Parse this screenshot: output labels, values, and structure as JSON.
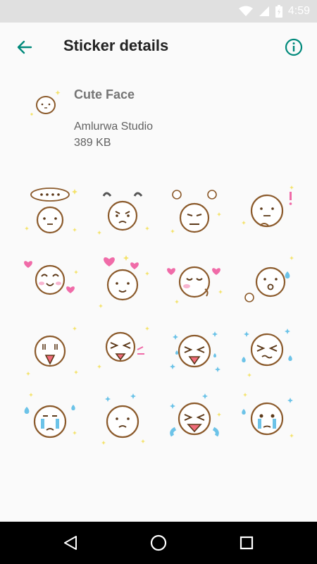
{
  "status_bar": {
    "time": "4:59",
    "icons": [
      "wifi-icon",
      "signal-icon",
      "battery-icon"
    ]
  },
  "app_bar": {
    "title": "Sticker details",
    "back_icon": "arrow-back-icon",
    "info_icon": "info-icon",
    "accent_color": "#00897b"
  },
  "pack": {
    "name": "Cute Face",
    "publisher": "Amlurwa Studio",
    "size": "389 KB"
  },
  "stickers": [
    {
      "expression": "speech-bubble-neutral"
    },
    {
      "expression": "annoyed"
    },
    {
      "expression": "grumpy-steam"
    },
    {
      "expression": "thinking-exclaim"
    },
    {
      "expression": "happy-hearts"
    },
    {
      "expression": "in-love"
    },
    {
      "expression": "blushing-hearts"
    },
    {
      "expression": "surprised-sweat"
    },
    {
      "expression": "shocked"
    },
    {
      "expression": "laughing"
    },
    {
      "expression": "laughing-sparkles"
    },
    {
      "expression": "crying-sweat"
    },
    {
      "expression": "crying-tears"
    },
    {
      "expression": "sad"
    },
    {
      "expression": "bawling"
    },
    {
      "expression": "teary"
    }
  ],
  "nav_bar": {
    "icons": [
      "nav-back-icon",
      "nav-home-icon",
      "nav-recents-icon"
    ]
  }
}
